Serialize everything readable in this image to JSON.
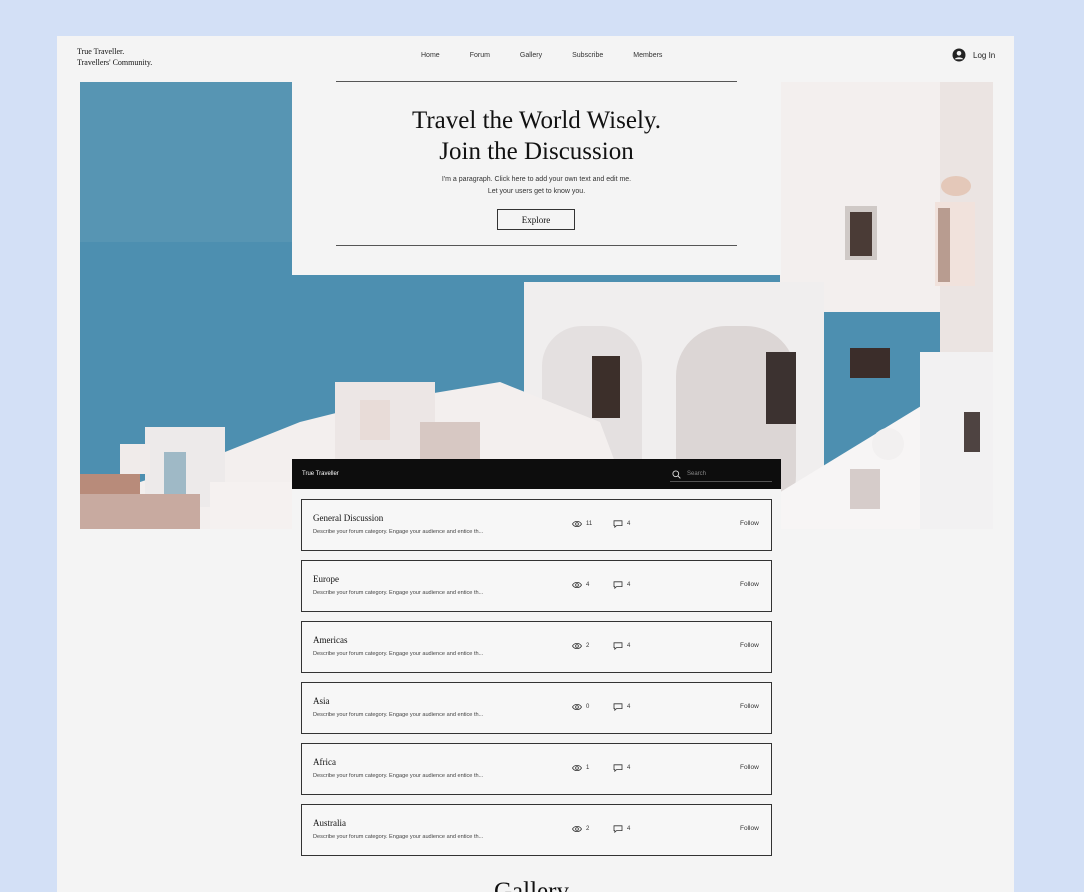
{
  "brand": {
    "line1": "True Traveller.",
    "line2": "Travellers' Community."
  },
  "nav": [
    "Home",
    "Forum",
    "Gallery",
    "Subscribe",
    "Members"
  ],
  "login": {
    "label": "Log In"
  },
  "hero": {
    "title_line1": "Travel the World Wisely.",
    "title_line2": "Join the Discussion",
    "para_line1": "I'm a paragraph. Click here to add your own text and edit me.",
    "para_line2": "Let your users get to know you.",
    "button": "Explore"
  },
  "forum": {
    "title": "True Traveller",
    "search_placeholder": "Search",
    "categories": [
      {
        "name": "General Discussion",
        "desc": "Describe your forum category. Engage your audience and entice th...",
        "views": "11",
        "posts": "4",
        "follow": "Follow"
      },
      {
        "name": "Europe",
        "desc": "Describe your forum category. Engage your audience and entice th...",
        "views": "4",
        "posts": "4",
        "follow": "Follow"
      },
      {
        "name": "Americas",
        "desc": "Describe your forum category. Engage your audience and entice th...",
        "views": "2",
        "posts": "4",
        "follow": "Follow"
      },
      {
        "name": "Asia",
        "desc": "Describe your forum category. Engage your audience and entice th...",
        "views": "0",
        "posts": "4",
        "follow": "Follow"
      },
      {
        "name": "Africa",
        "desc": "Describe your forum category. Engage your audience and entice th...",
        "views": "1",
        "posts": "4",
        "follow": "Follow"
      },
      {
        "name": "Australia",
        "desc": "Describe your forum category. Engage your audience and entice th...",
        "views": "2",
        "posts": "4",
        "follow": "Follow"
      }
    ]
  },
  "gallery": {
    "title": "Gallery"
  },
  "icons": {
    "login": "user-circle-icon",
    "search": "search-icon",
    "views": "eye-icon",
    "posts": "comment-icon"
  },
  "colors": {
    "sky": "#4d8fb0",
    "page": "#f4f4f4",
    "backdrop": "#d3e0f6",
    "bar": "#0d0d0d"
  }
}
